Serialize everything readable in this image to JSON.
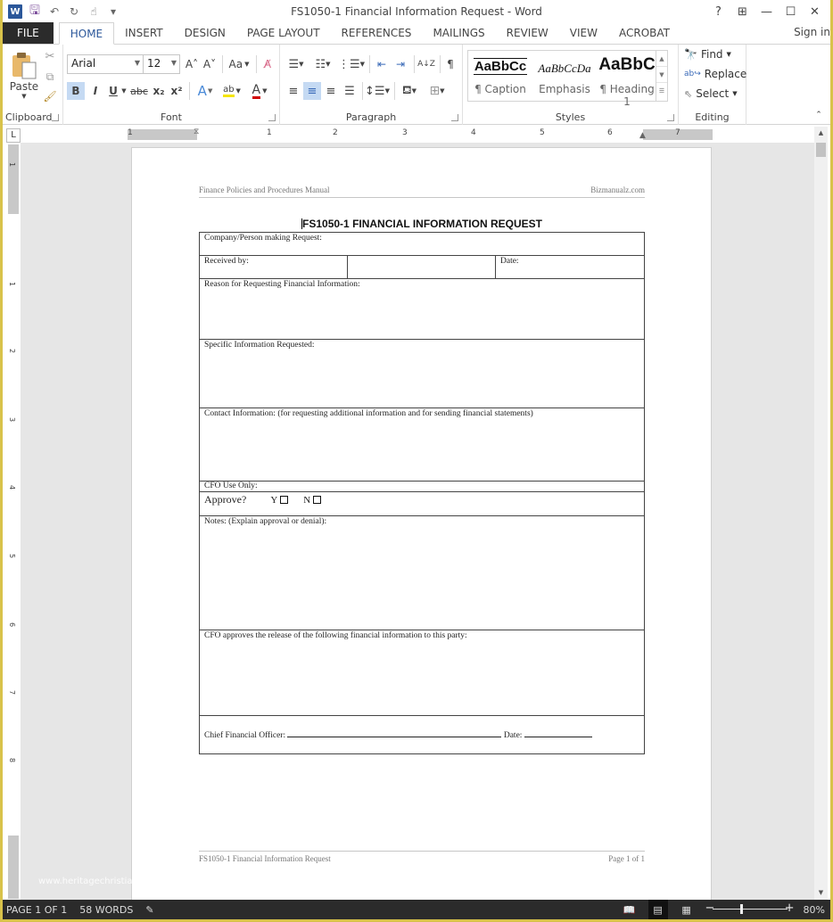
{
  "window": {
    "title": "FS1050-1 Financial Information Request - Word",
    "controls": {
      "help": "?",
      "ribbon_display": "⊞",
      "minimize": "—",
      "maximize": "☐",
      "close": "✕"
    },
    "sign_in": "Sign in"
  },
  "quick_access": {
    "word_logo": "W",
    "save": "🖫",
    "undo": "↶",
    "redo": "↻",
    "touch": "☝",
    "customize": "▾"
  },
  "tabs": [
    {
      "label": "FILE"
    },
    {
      "label": "HOME",
      "active": true
    },
    {
      "label": "INSERT"
    },
    {
      "label": "DESIGN"
    },
    {
      "label": "PAGE LAYOUT"
    },
    {
      "label": "REFERENCES"
    },
    {
      "label": "MAILINGS"
    },
    {
      "label": "REVIEW"
    },
    {
      "label": "VIEW"
    },
    {
      "label": "ACROBAT"
    }
  ],
  "ribbon": {
    "clipboard": {
      "label": "Clipboard",
      "paste": "Paste"
    },
    "font": {
      "label": "Font",
      "font_name": "Arial",
      "font_size": "12",
      "grow": "A˄",
      "shrink": "A˅",
      "change_case": "Aa",
      "bold": "B",
      "italic": "I",
      "underline": "U",
      "strikethrough": "abc",
      "subscript": "x₂",
      "superscript": "x²",
      "text_effects": "A",
      "highlight": "ab",
      "font_color": "A",
      "highlight_color": "#f5e500",
      "font_color_value": "#d00000"
    },
    "paragraph": {
      "label": "Paragraph",
      "pilcrow": "¶",
      "sort": "A↓Z"
    },
    "styles": {
      "label": "Styles",
      "items": [
        {
          "sample": "AaBbCc",
          "name": "¶ Caption"
        },
        {
          "sample": "AaBbCcDa",
          "name": "Emphasis"
        },
        {
          "sample": "AaBbC",
          "name": "¶ Heading 1"
        }
      ]
    },
    "editing": {
      "label": "Editing",
      "find": "Find",
      "replace": "Replace",
      "select": "Select"
    }
  },
  "rulers": {
    "horizontal_numbers": [
      "1",
      "1",
      "2",
      "3",
      "4",
      "5",
      "6",
      "7"
    ],
    "vertical_numbers": [
      "1",
      "1",
      "2",
      "3",
      "4",
      "5",
      "6",
      "7",
      "8"
    ],
    "tab_selector": "L"
  },
  "document": {
    "header_left": "Finance Policies and Procedures Manual",
    "header_right": "Bizmanualz.com",
    "title": "FS1050-1 FINANCIAL INFORMATION REQUEST",
    "form": {
      "company": "Company/Person making Request:",
      "received_by": "Received by:",
      "date": "Date:",
      "reason": "Reason for Requesting Financial Information:",
      "specific": "Specific Information Requested:",
      "contact": "Contact Information: (for requesting additional information and for sending financial statements)",
      "cfo_use": "CFO Use Only:",
      "approve": "Approve?",
      "yes": "Y",
      "no": "N",
      "notes": "Notes: (Explain approval or denial):",
      "release": "CFO approves the release of the following financial information to this party:",
      "cfo_sig": "Chief Financial Officer:",
      "sig_date": "Date:"
    },
    "footer_left": "FS1050-1 Financial Information Request",
    "footer_right": "Page 1 of 1"
  },
  "watermark": "www.heritagechristiancollege.com",
  "status": {
    "page": "PAGE 1 OF 1",
    "words": "58 WORDS",
    "proofing_icon": "📖",
    "zoom": "80%",
    "zoom_value_percent": 80
  }
}
